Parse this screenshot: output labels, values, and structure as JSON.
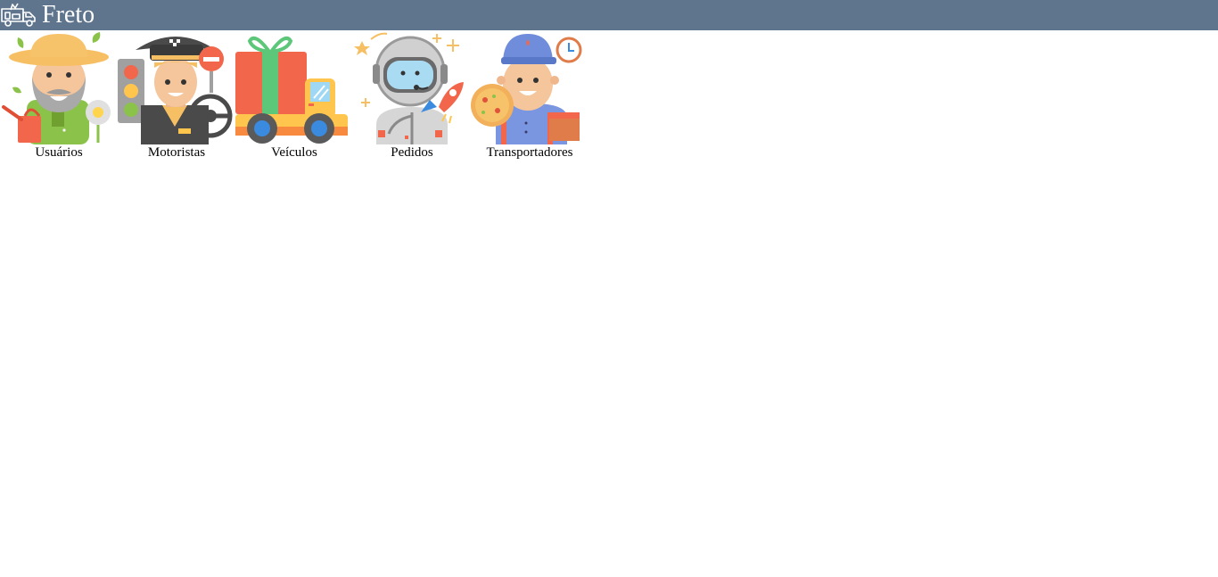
{
  "app": {
    "title": "Freto",
    "logo_icon": "truck-icon",
    "header_color": "#5f758d"
  },
  "menu": {
    "items": [
      {
        "label": "Usuários",
        "icon": "farmer-icon"
      },
      {
        "label": "Motoristas",
        "icon": "taxi-driver-icon"
      },
      {
        "label": "Veículos",
        "icon": "delivery-truck-icon"
      },
      {
        "label": "Pedidos",
        "icon": "astronaut-icon"
      },
      {
        "label": "Transportadores",
        "icon": "delivery-man-icon"
      }
    ]
  }
}
